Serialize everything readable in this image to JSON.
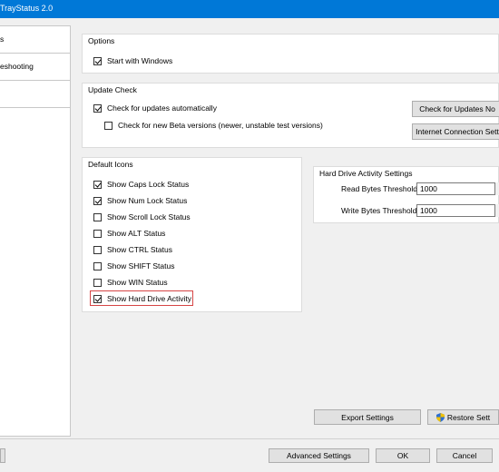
{
  "window": {
    "title": "TrayStatus 2.0"
  },
  "sidebar": {
    "items": [
      {
        "label": "s"
      },
      {
        "label": "eshooting"
      }
    ]
  },
  "options": {
    "group_title": "Options",
    "start_with_windows": {
      "label": "Start with Windows",
      "checked": true
    }
  },
  "update_check": {
    "group_title": "Update Check",
    "auto": {
      "label": "Check for updates automatically",
      "checked": true
    },
    "beta": {
      "label": "Check for new Beta versions (newer, unstable test versions)",
      "checked": false
    },
    "check_now_label": "Check for Updates No",
    "internet_settings_label": "Internet Connection Sett"
  },
  "default_icons": {
    "group_title": "Default Icons",
    "items": [
      {
        "label": "Show Caps Lock Status",
        "checked": true
      },
      {
        "label": "Show Num Lock Status",
        "checked": true
      },
      {
        "label": "Show Scroll Lock Status",
        "checked": false
      },
      {
        "label": "Show ALT Status",
        "checked": false
      },
      {
        "label": "Show CTRL Status",
        "checked": false
      },
      {
        "label": "Show SHIFT Status",
        "checked": false
      },
      {
        "label": "Show WIN Status",
        "checked": false
      },
      {
        "label": "Show Hard Drive Activity",
        "checked": true
      }
    ]
  },
  "hdd": {
    "group_title": "Hard Drive Activity Settings",
    "read_label": "Read Bytes Threshold:",
    "read_value": "1000",
    "write_label": "Write Bytes Threshold:",
    "write_value": "1000"
  },
  "buttons": {
    "export": "Export Settings",
    "restore": "Restore Sett",
    "advanced": "Advanced Settings",
    "ok": "OK",
    "cancel": "Cancel"
  },
  "colors": {
    "titlebar": "#0078d7",
    "highlight": "#d64545"
  }
}
